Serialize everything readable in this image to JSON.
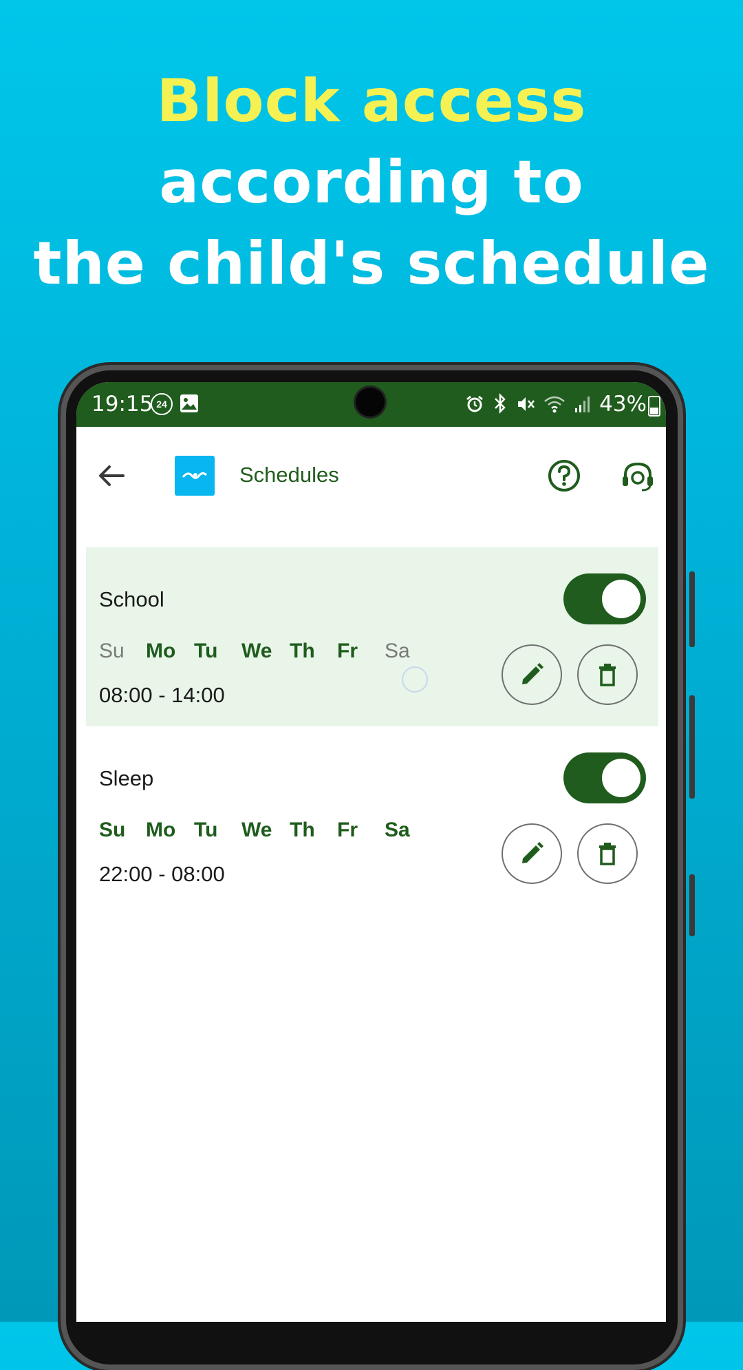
{
  "promo": {
    "line1": "Block access",
    "line2": "according to",
    "line3": "the child's schedule"
  },
  "status_bar": {
    "time": "19:15",
    "badge": "24",
    "battery": "43%"
  },
  "app_bar": {
    "title": "Schedules",
    "icons": [
      "back-arrow-icon",
      "app-logo-icon",
      "help-icon",
      "support-headset-icon"
    ]
  },
  "schedules": [
    {
      "name": "School",
      "enabled": true,
      "days": [
        {
          "label": "Su",
          "active": false
        },
        {
          "label": "Mo",
          "active": true
        },
        {
          "label": "Tu",
          "active": true
        },
        {
          "label": "We",
          "active": true
        },
        {
          "label": "Th",
          "active": true
        },
        {
          "label": "Fr",
          "active": true
        },
        {
          "label": "Sa",
          "active": false
        }
      ],
      "time": "08:00 - 14:00"
    },
    {
      "name": "Sleep",
      "enabled": true,
      "days": [
        {
          "label": "Su",
          "active": true
        },
        {
          "label": "Mo",
          "active": true
        },
        {
          "label": "Tu",
          "active": true
        },
        {
          "label": "We",
          "active": true
        },
        {
          "label": "Th",
          "active": true
        },
        {
          "label": "Fr",
          "active": true
        },
        {
          "label": "Sa",
          "active": true
        }
      ],
      "time": "22:00 - 08:00"
    }
  ],
  "colors": {
    "headline_accent": "#f5f153",
    "primary_green": "#1f5c1d",
    "highlight_bg": "#e8f5e8",
    "logo_blue": "#08b7ef"
  }
}
